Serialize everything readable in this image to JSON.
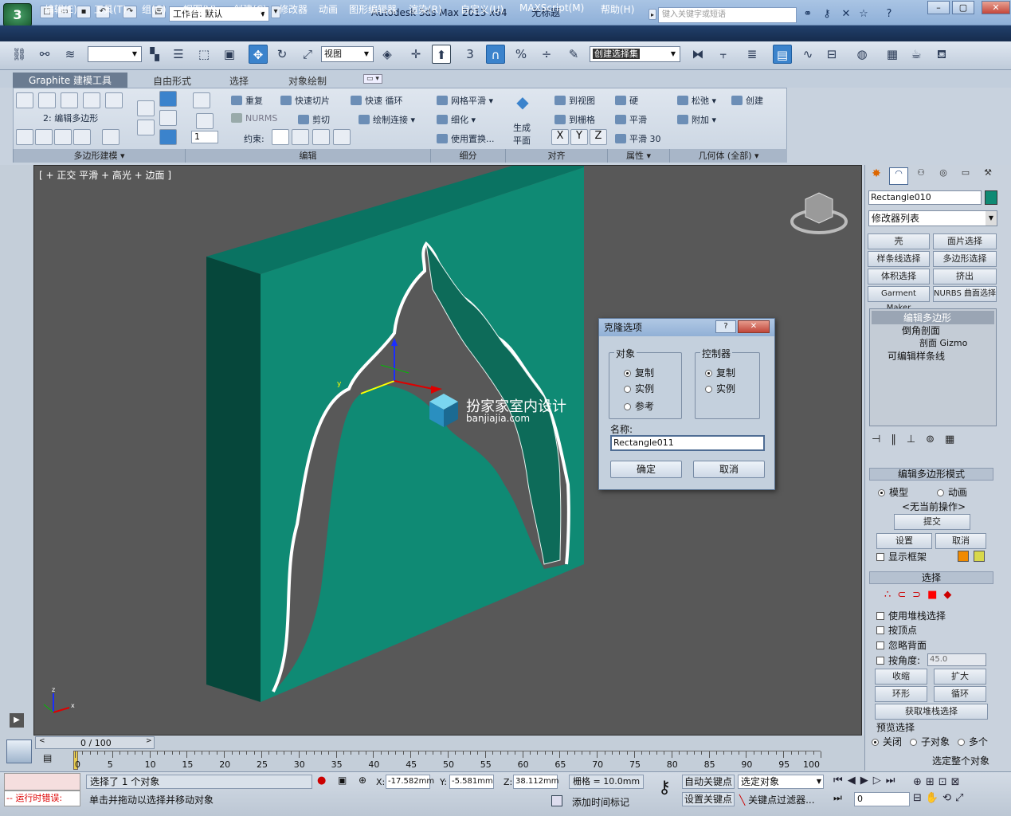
{
  "titlebar": {
    "workspace_label": "工作台: 默认",
    "app_title": "Autodesk 3ds Max  2013 x64",
    "doc_title": "无标题",
    "search_placeholder": "键入关键字或短语"
  },
  "menus": [
    "编辑(E)",
    "工具(T)",
    "组(G)",
    "视图(V)",
    "创建(C)",
    "修改器",
    "动画",
    "图形编辑器",
    "渲染(R)",
    "自定义(U)",
    "MAXScript(M)",
    "帮助(H)"
  ],
  "toolbar": {
    "view_dropdown": "视图",
    "selection_set": "创建选择集",
    "snap_label": "3"
  },
  "ribbon": {
    "tabs": [
      "Graphite 建模工具",
      "自由形式",
      "选择",
      "对象绘制"
    ],
    "poly_label": "2: 编辑多边形",
    "edit": {
      "repeat": "重复",
      "quickslice": "快速切片",
      "quickloop": "快速 循环",
      "nurms": "NURMS",
      "cut": "剪切",
      "paintconnect": "绘制连接",
      "constraint": "约束:",
      "spinner": "1"
    },
    "subdiv": {
      "meshsmooth": "网格平滑",
      "tessellate": "细化",
      "usedisp": "使用置换..."
    },
    "align": {
      "generate": "生成",
      "plane": "平面",
      "toview": "到视图",
      "togrid": "到栅格",
      "x": "X",
      "y": "Y",
      "z": "Z"
    },
    "props": {
      "hard": "硬",
      "smooth": "平滑",
      "smooth30": "平滑 30"
    },
    "geom": {
      "relax": "松弛",
      "create": "创建",
      "attach": "附加"
    },
    "panels": [
      "多边形建模",
      "编辑",
      "细分",
      "对齐",
      "属性",
      "几何体 (全部)"
    ]
  },
  "viewport": {
    "label": "[ + 正交 平滑 + 高光 + 边面 ]",
    "watermark_cn": "扮家家室内设计",
    "watermark_en": "banjiajia.com"
  },
  "dialog": {
    "title": "克隆选项",
    "object_group": "对象",
    "obj_options": [
      "复制",
      "实例",
      "参考"
    ],
    "controller_group": "控制器",
    "ctrl_options": [
      "复制",
      "实例"
    ],
    "name_label": "名称:",
    "name_value": "Rectangle011",
    "ok": "确定",
    "cancel": "取消"
  },
  "command_panel": {
    "object_name": "Rectangle010",
    "modifier_list": "修改器列表",
    "mod_buttons": [
      "壳",
      "面片选择",
      "样条线选择",
      "多边形选择",
      "体积选择",
      "挤出",
      "Garment Maker",
      "NURBS 曲面选择"
    ],
    "stack": [
      "编辑多边形",
      "倒角剖面",
      "剖面 Gizmo",
      "可编辑样条线"
    ],
    "rollout_mode": "编辑多边形模式",
    "mode_model": "模型",
    "mode_anim": "动画",
    "no_op": "<无当前操作>",
    "commit": "提交",
    "settings": "设置",
    "cancel": "取消",
    "show_cage": "显示框架",
    "rollout_select": "选择",
    "use_stack": "使用堆栈选择",
    "by_vertex": "按顶点",
    "ignore_back": "忽略背面",
    "by_angle": "按角度:",
    "angle_value": "45.0",
    "shrink": "收缩",
    "grow": "扩大",
    "ring": "环形",
    "loop": "循环",
    "get_stack": "获取堆栈选择",
    "preview": "预览选择",
    "off": "关闭",
    "subobj": "子对象",
    "multi": "多个",
    "select_whole": "选定整个对象"
  },
  "timeline": {
    "frame": "0 / 100",
    "ticks": [
      "0",
      "5",
      "10",
      "15",
      "20",
      "25",
      "30",
      "35",
      "40",
      "45",
      "50",
      "55",
      "60",
      "65",
      "70",
      "75",
      "80",
      "85",
      "90",
      "95",
      "100"
    ]
  },
  "status": {
    "selected": "选择了 1 个对象",
    "hint": "单击并拖动以选择并移动对象",
    "error": "-- 运行时错误:",
    "x": "-17.582mm",
    "y": "-5.581mm",
    "z": "38.112mm",
    "grid": "栅格 = 10.0mm",
    "autokey": "自动关键点",
    "setkey": "设置关键点",
    "selobj": "选定对象",
    "keyfilter": "关键点过滤器...",
    "addtime": "添加时间标记",
    "frame_field": "0"
  },
  "colors": {
    "object_fill": "#0f8a74",
    "object_side": "#075a4a",
    "viewport_bg": "#585858",
    "active_blue": "#3b83cc"
  }
}
